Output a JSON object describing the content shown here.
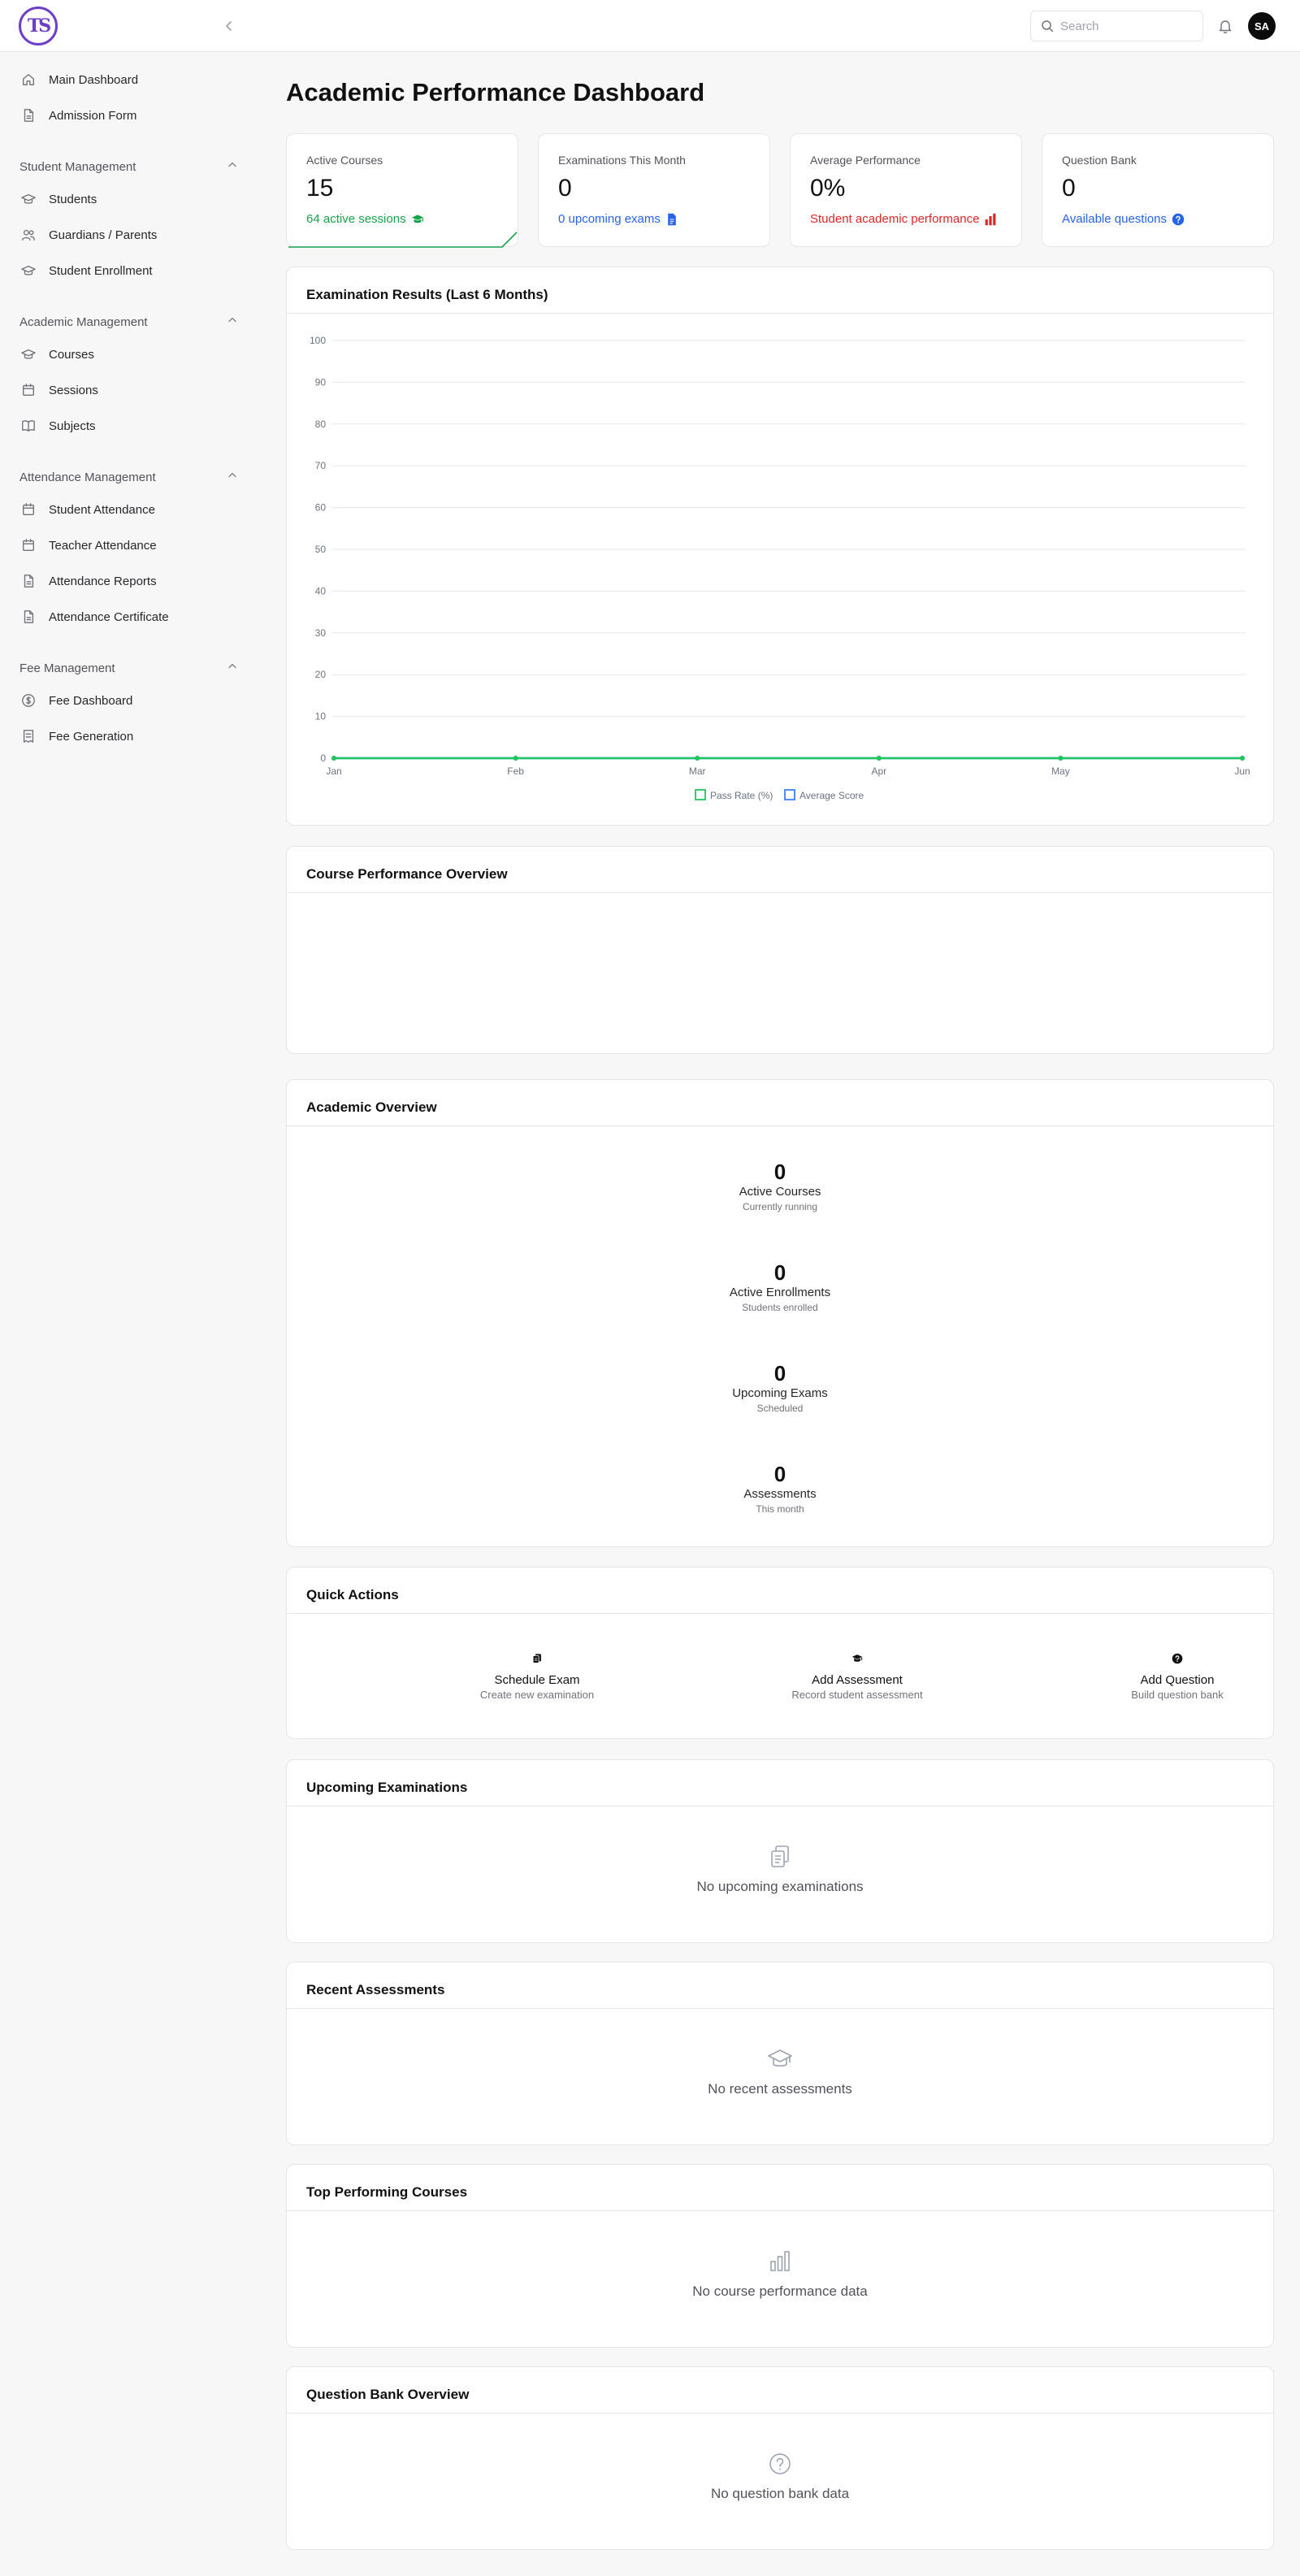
{
  "app": {
    "logo_text": "TS",
    "user_initials": "SA"
  },
  "search": {
    "placeholder": "Search",
    "value": ""
  },
  "sidebar": {
    "top_items": [
      {
        "label": "Main Dashboard",
        "icon": "home-icon"
      },
      {
        "label": "Admission Form",
        "icon": "document-icon"
      }
    ],
    "sections": [
      {
        "title": "Student Management",
        "items": [
          {
            "label": "Students",
            "icon": "graduation-cap-icon"
          },
          {
            "label": "Guardians / Parents",
            "icon": "users-icon"
          },
          {
            "label": "Student Enrollment",
            "icon": "graduation-cap-icon"
          }
        ]
      },
      {
        "title": "Academic Management",
        "items": [
          {
            "label": "Courses",
            "icon": "graduation-cap-icon"
          },
          {
            "label": "Sessions",
            "icon": "calendar-icon"
          },
          {
            "label": "Subjects",
            "icon": "book-icon"
          }
        ]
      },
      {
        "title": "Attendance Management",
        "items": [
          {
            "label": "Student Attendance",
            "icon": "calendar-icon"
          },
          {
            "label": "Teacher Attendance",
            "icon": "calendar-icon"
          },
          {
            "label": "Attendance Reports",
            "icon": "document-icon"
          },
          {
            "label": "Attendance Certificate",
            "icon": "document-icon"
          }
        ]
      },
      {
        "title": "Fee Management",
        "items": [
          {
            "label": "Fee Dashboard",
            "icon": "dollar-circle-icon"
          },
          {
            "label": "Fee Generation",
            "icon": "receipt-icon"
          }
        ]
      }
    ]
  },
  "page": {
    "title": "Academic Performance Dashboard"
  },
  "stats": [
    {
      "label": "Active Courses",
      "value": "15",
      "sub": "64 active sessions",
      "color": "#16a34a",
      "icon": "graduation-cap-icon"
    },
    {
      "label": "Examinations This Month",
      "value": "0",
      "sub": "0 upcoming exams",
      "color": "#2563eb",
      "icon": "document-icon"
    },
    {
      "label": "Average Performance",
      "value": "0%",
      "sub": "Student academic performance",
      "color": "#dc2626",
      "icon": "bar-chart-icon"
    },
    {
      "label": "Question Bank",
      "value": "0",
      "sub": "Available questions",
      "color": "#2563eb",
      "icon": "question-circle-icon"
    }
  ],
  "exam_chart": {
    "title": "Examination Results (Last 6 Months)",
    "legend": [
      "Pass Rate (%)",
      "Average Score"
    ]
  },
  "chart_data": {
    "type": "line",
    "title": "Examination Results (Last 6 Months)",
    "categories": [
      "Jan",
      "Feb",
      "Mar",
      "Apr",
      "May",
      "Jun"
    ],
    "series": [
      {
        "name": "Pass Rate (%)",
        "values": [
          0,
          0,
          0,
          0,
          0,
          0
        ],
        "color": "#22c55e"
      },
      {
        "name": "Average Score",
        "values": [
          0,
          0,
          0,
          0,
          0,
          0
        ],
        "color": "#3b82f6"
      }
    ],
    "y_ticks": [
      "0",
      "10",
      "20",
      "30",
      "40",
      "50",
      "60",
      "70",
      "80",
      "90",
      "100"
    ],
    "ylim": [
      0,
      100
    ],
    "grid": true,
    "legend_position": "bottom-center"
  },
  "course_performance": {
    "title": "Course Performance Overview"
  },
  "academic_overview": {
    "title": "Academic Overview",
    "items": [
      {
        "value": "0",
        "label": "Active Courses",
        "sub": "Currently running"
      },
      {
        "value": "0",
        "label": "Active Enrollments",
        "sub": "Students enrolled"
      },
      {
        "value": "0",
        "label": "Upcoming Exams",
        "sub": "Scheduled"
      },
      {
        "value": "0",
        "label": "Assessments",
        "sub": "This month"
      }
    ]
  },
  "quick_actions": {
    "title": "Quick Actions",
    "items": [
      {
        "label": "Schedule Exam",
        "sub": "Create new examination",
        "icon": "copy-icon"
      },
      {
        "label": "Add Assessment",
        "sub": "Record student assessment",
        "icon": "graduation-cap-icon"
      },
      {
        "label": "Add Question",
        "sub": "Build question bank",
        "icon": "question-circle-icon"
      }
    ]
  },
  "upcoming_exams": {
    "title": "Upcoming Examinations",
    "empty": "No upcoming examinations"
  },
  "recent_assessments": {
    "title": "Recent Assessments",
    "empty": "No recent assessments"
  },
  "top_courses": {
    "title": "Top Performing Courses",
    "empty": "No course performance data"
  },
  "question_bank": {
    "title": "Question Bank Overview",
    "empty": "No question bank data"
  }
}
